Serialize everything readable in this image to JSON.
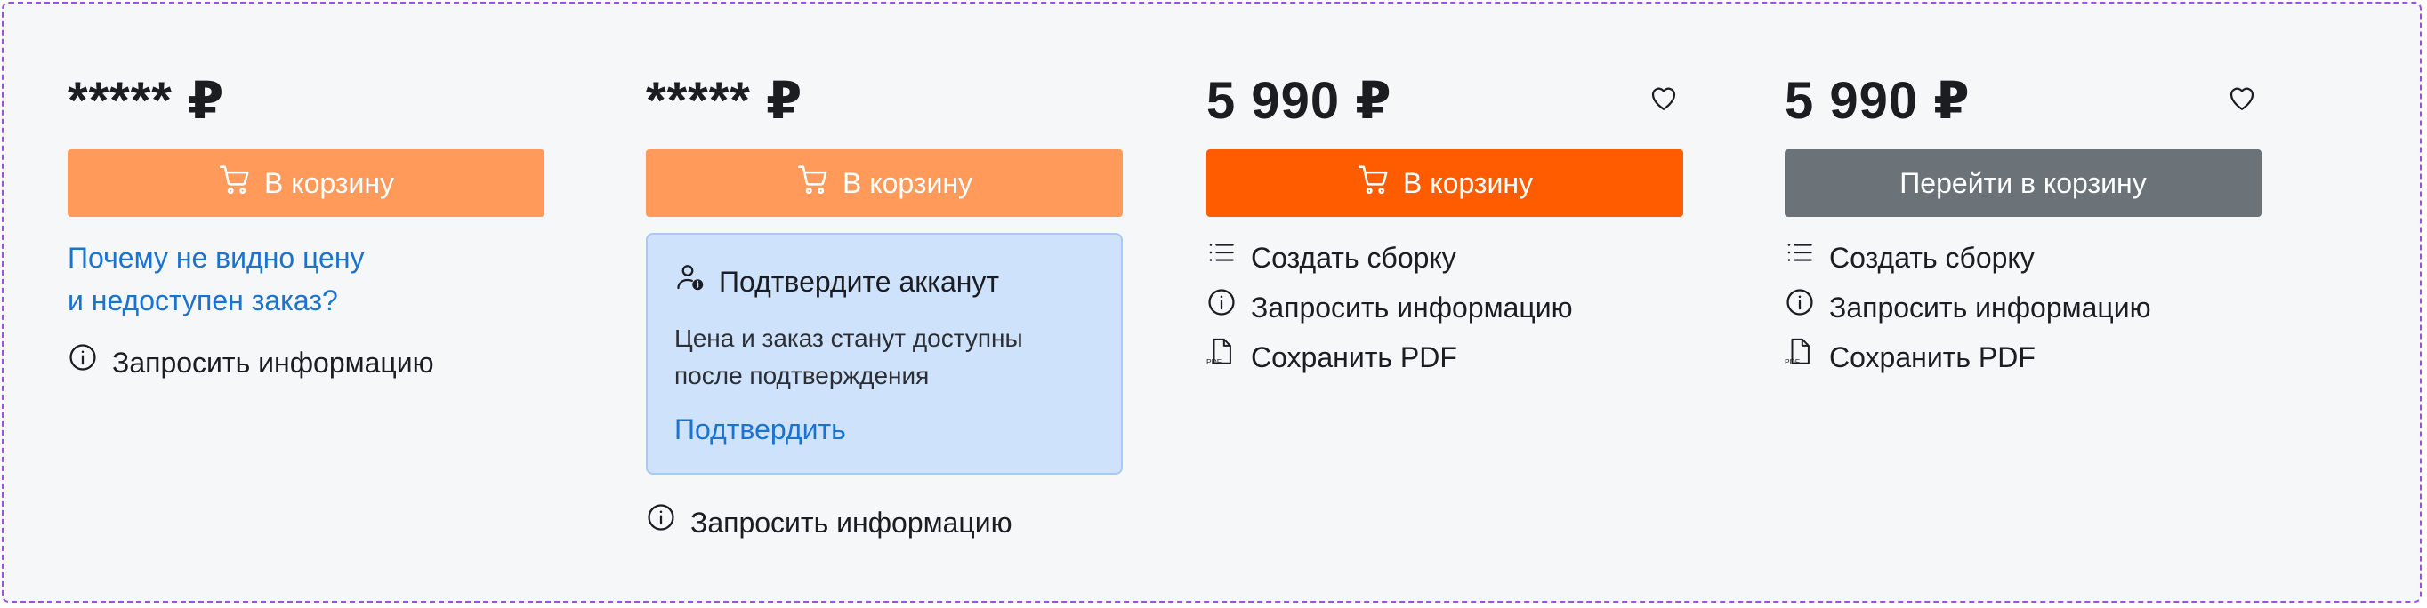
{
  "cards": [
    {
      "price": "***** ₽",
      "button": "В корзину",
      "link_line1": "Почему не видно цену",
      "link_line2": "и недоступен заказ?",
      "actions": [
        "Запросить информацию"
      ]
    },
    {
      "price": "***** ₽",
      "button": "В корзину",
      "notice": {
        "title": "Подтвердите акканут",
        "text_line1": "Цена и заказ станут доступны",
        "text_line2": "после подтверждения",
        "link": "Подтвердить"
      },
      "actions": [
        "Запросить информацию"
      ]
    },
    {
      "price": "5 990 ₽",
      "button": "В корзину",
      "actions": [
        "Создать сборку",
        "Запросить информацию",
        "Сохранить PDF"
      ]
    },
    {
      "price": "5 990 ₽",
      "button": "Перейти в корзину",
      "actions": [
        "Создать сборку",
        "Запросить информацию",
        "Сохранить PDF"
      ]
    }
  ],
  "icons": {
    "cart": "cart-icon",
    "heart": "heart-icon",
    "info": "info-icon",
    "list": "list-icon",
    "pdf": "pdf-file-icon",
    "user": "user-verify-icon",
    "pdf_badge": "PDF"
  },
  "colors": {
    "frame_border": "#9b51e0",
    "button_light": "#ff9a5b",
    "button_strong": "#ff5c00",
    "button_gray": "#6b7278",
    "link": "#1a73d1",
    "notice_bg": "#cfe2fc"
  }
}
